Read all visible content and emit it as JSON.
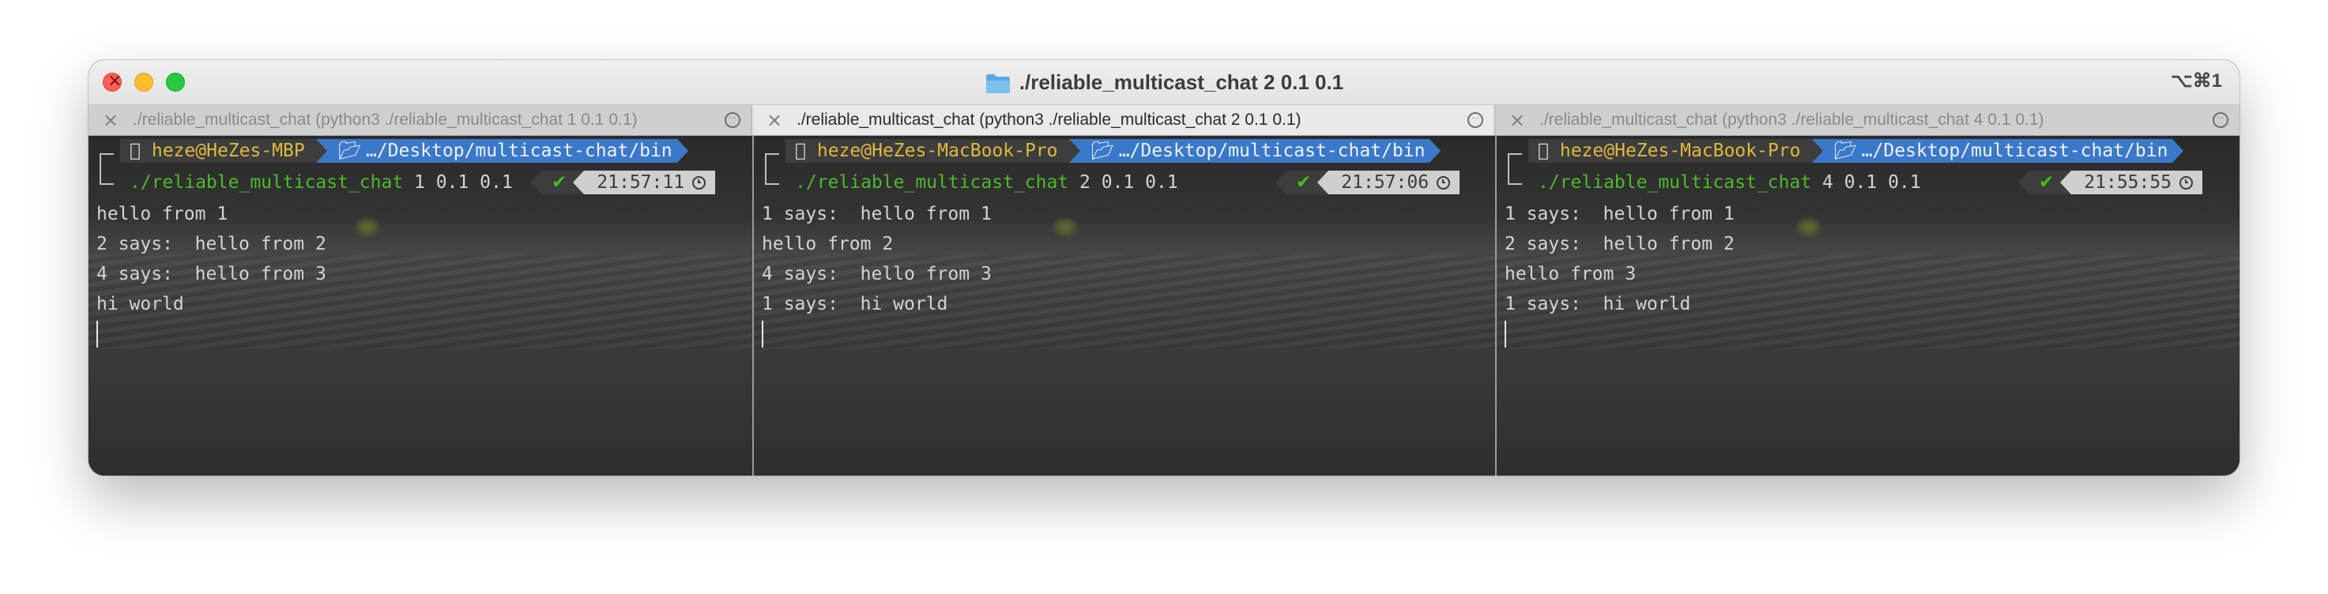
{
  "window": {
    "title": "./reliable_multicast_chat 2 0.1 0.1",
    "shortcut": "⌥⌘1"
  },
  "colors": {
    "user": "#e0b93b",
    "path_segment": "#3a79c9",
    "command": "#4eb82c",
    "check": "#3ec219",
    "time_segment": "#cfcfcf"
  },
  "tabs": [
    {
      "label": "./reliable_multicast_chat (python3 ./reliable_multicast_chat 1 0.1 0.1)",
      "active": false
    },
    {
      "label": "./reliable_multicast_chat (python3 ./reliable_multicast_chat 2 0.1 0.1)",
      "active": true
    },
    {
      "label": "./reliable_multicast_chat (python3 ./reliable_multicast_chat 4 0.1 0.1)",
      "active": false
    }
  ],
  "panes": [
    {
      "user": "heze@HeZes-MBP",
      "path": "…/Desktop/multicast-chat/bin",
      "command": "./reliable_multicast_chat",
      "args": "1 0.1 0.1",
      "time": "21:57:11",
      "lines": [
        "hello from 1",
        "2 says:  hello from 2",
        "4 says:  hello from 3",
        "hi world"
      ]
    },
    {
      "user": "heze@HeZes-MacBook-Pro",
      "path": "…/Desktop/multicast-chat/bin",
      "command": "./reliable_multicast_chat",
      "args": "2 0.1 0.1",
      "time": "21:57:06",
      "lines": [
        "1 says:  hello from 1",
        "hello from 2",
        "4 says:  hello from 3",
        "1 says:  hi world"
      ]
    },
    {
      "user": "heze@HeZes-MacBook-Pro",
      "path": "…/Desktop/multicast-chat/bin",
      "command": "./reliable_multicast_chat",
      "args": "4 0.1 0.1",
      "time": "21:55:55",
      "lines": [
        "1 says:  hello from 1",
        "2 says:  hello from 2",
        "hello from 3",
        "1 says:  hi world"
      ]
    }
  ],
  "icons": {
    "tab_close": "close-icon",
    "tab_more": "more-icon",
    "prompt_os": "apple-icon",
    "prompt_folder": "folder-icon",
    "status_ok": "check-icon",
    "status_time": "clock-icon"
  }
}
